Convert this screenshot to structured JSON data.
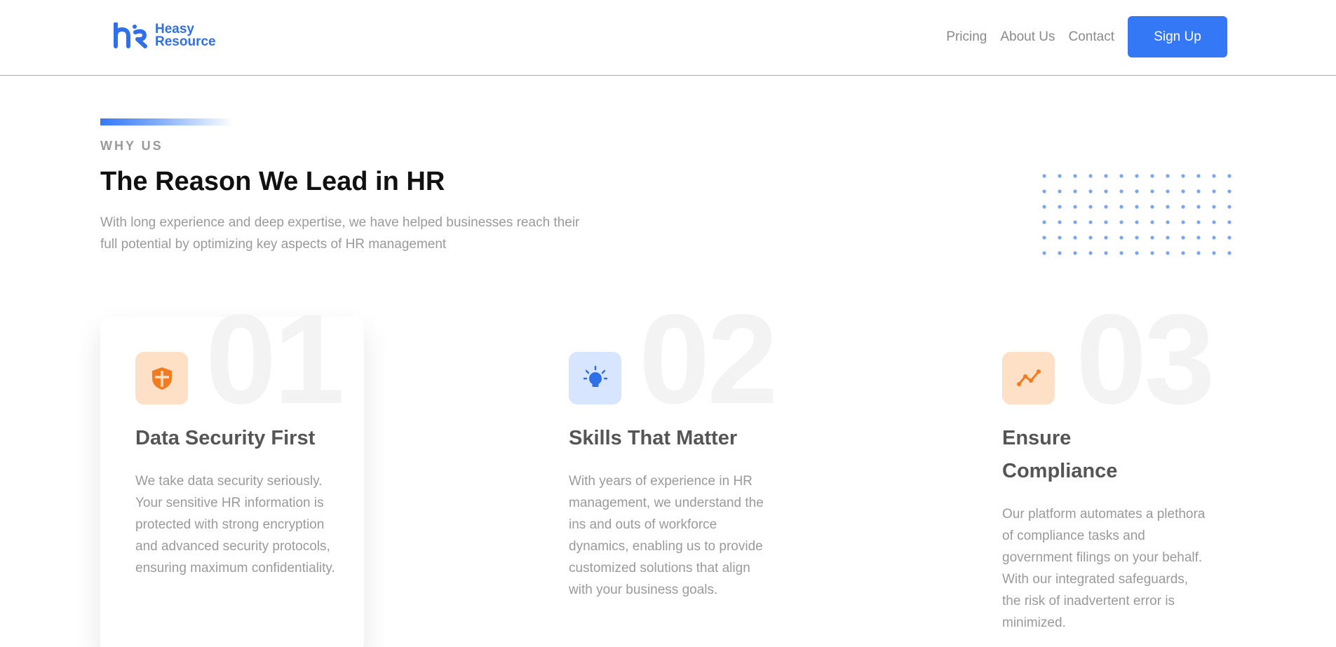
{
  "brand": {
    "name_line1": "Heasy",
    "name_line2": "Resource",
    "color": "#2f6fe8"
  },
  "nav": {
    "items": [
      "Pricing",
      "About Us",
      "Contact"
    ],
    "signup_label": "Sign Up",
    "accent": "#3578f6"
  },
  "intro": {
    "eyebrow": "WHY US",
    "headline": "The Reason We Lead in HR",
    "lede": "With long experience and deep expertise, we have helped businesses reach their full potential by optimizing key aspects of HR management"
  },
  "cards": [
    {
      "number": "01",
      "icon": "shield-icon",
      "title": "Data Security First",
      "text": "We take data security seriously. Your sensitive HR information is protected with strong encryption and advanced security protocols, ensuring maximum confidentiality."
    },
    {
      "number": "02",
      "icon": "lightbulb-icon",
      "title": "Skills That Matter",
      "text": "With years of experience in HR management, we understand the ins and outs of workforce dynamics, enabling us to provide customized solutions that align with your business goals."
    },
    {
      "number": "03",
      "icon": "line-chart-icon",
      "title": "Ensure Compliance",
      "text": "Our platform automates a plethora of compliance tasks and government filings on your behalf. With our integrated safeguards, the risk of inadvertent error is minimized."
    }
  ]
}
